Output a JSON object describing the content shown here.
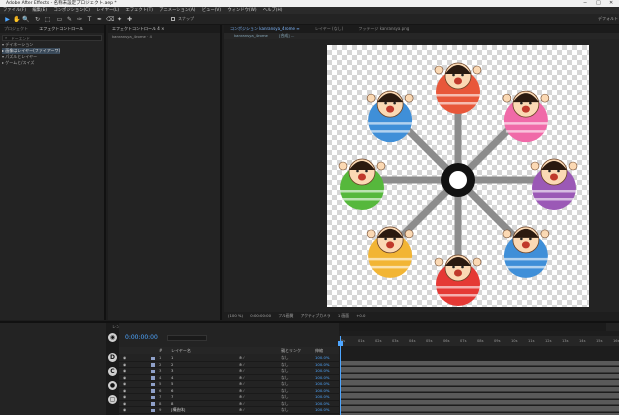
{
  "window": {
    "title": "Adobe After Effects - 名称未設定プロジェクト.aep *",
    "controls": [
      "−",
      "□",
      "✕"
    ]
  },
  "menu": [
    "ファイル(F)",
    "編集(E)",
    "コンポジション(C)",
    "レイヤー(L)",
    "エフェクト(T)",
    "アニメーション(A)",
    "ビュー(V)",
    "ウィンドウ(W)",
    "ヘルプ(H)"
  ],
  "toolbar": {
    "tools": [
      "▶",
      "✋",
      "🔍",
      "↻",
      "⬚",
      "▭",
      "✎",
      "✑",
      "T",
      "✒",
      "⌫",
      "✦",
      "✚"
    ],
    "snap_label": "スナップ",
    "workspace": "デフォルト"
  },
  "project_panel": {
    "tabs": [
      "プロジェクト",
      "エフェクトコントロール"
    ],
    "search_placeholder": "ドーエンド",
    "items": [
      {
        "label": "▾ デイネーション"
      },
      {
        "label": "  ▸ 画像はレイヤー(ファイアーワ)"
      },
      {
        "label": "▾ パズルとレイヤー"
      },
      {
        "label": "  ▸ ゲームと/スイズ"
      }
    ]
  },
  "effects_panel": {
    "tab": "エフェクトコントロール 4 ×",
    "subtitle": "kanransya_4rome · 4"
  },
  "viewer": {
    "tabs": [
      "コンポジション kanransya_4rome ≡",
      "レイヤー (なし)",
      "フッテージ kanransya.png"
    ],
    "subtabs": [
      "kanransya_4rome",
      "[合成] ..."
    ],
    "controls": [
      "(100 %)",
      "0:00:00:00",
      "フル画質",
      "アクティブカメラ",
      "1 画面",
      "+0.0"
    ]
  },
  "timeline": {
    "tabs": [
      "レンダーキュー",
      "kanransya_4rome ≡"
    ],
    "timecode": "0:00:00:00",
    "columns": [
      "#",
      "レイヤー名",
      "親とリンク",
      "伸縮"
    ],
    "layers": [
      {
        "num": "1",
        "name": "1",
        "parent": "なし",
        "dur": "100.0%"
      },
      {
        "num": "2",
        "name": "2",
        "parent": "なし",
        "dur": "100.0%"
      },
      {
        "num": "3",
        "name": "3",
        "parent": "なし",
        "dur": "100.0%"
      },
      {
        "num": "4",
        "name": "4",
        "parent": "なし",
        "dur": "100.0%"
      },
      {
        "num": "5",
        "name": "5",
        "parent": "なし",
        "dur": "100.0%"
      },
      {
        "num": "6",
        "name": "6",
        "parent": "なし",
        "dur": "100.0%"
      },
      {
        "num": "7",
        "name": "7",
        "parent": "なし",
        "dur": "100.0%"
      },
      {
        "num": "8",
        "name": "8",
        "parent": "なし",
        "dur": "100.0%"
      },
      {
        "num": "9",
        "name": "[構造体]",
        "parent": "なし",
        "dur": "100.0%"
      }
    ],
    "ruler": [
      "0s",
      "01s",
      "02s",
      "03s",
      "04s",
      "05s",
      "06s",
      "07s",
      "08s",
      "09s",
      "10s",
      "11s",
      "12s",
      "13s",
      "14s",
      "15s",
      "16s"
    ]
  },
  "colors": {
    "accent": "#4ea6ff",
    "gondola": [
      "#e8573a",
      "#f06aa8",
      "#9b59b6",
      "#3f8fd8",
      "#e53935",
      "#f2b534",
      "#56b83c",
      "#3f8fd8"
    ]
  }
}
